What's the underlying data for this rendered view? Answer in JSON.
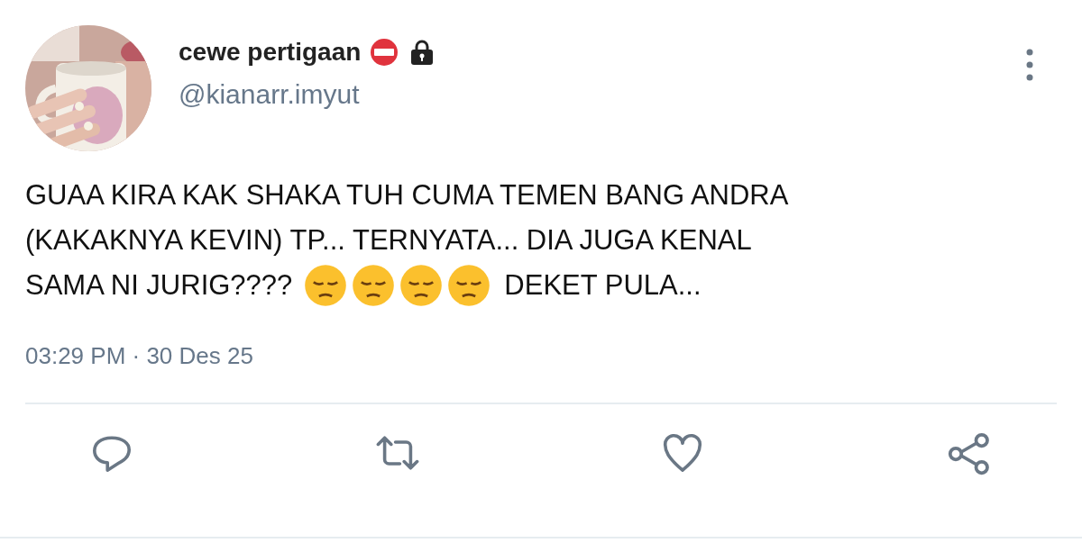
{
  "author": {
    "name": "cewe pertigaan",
    "handle": "@kianarr.imyut"
  },
  "body_lines": [
    [
      {
        "kind": "text",
        "text": "GUAA KIRA KAK SHAKA TUH CUMA TEMEN BANG ANDRA"
      }
    ],
    [
      {
        "kind": "text",
        "text": "(KAKAKNYA KEVIN) TP... TERNYATA... DIA JUGA KENAL"
      }
    ],
    [
      {
        "kind": "text",
        "text": "SAMA NI JURIG????"
      },
      {
        "kind": "emoji"
      },
      {
        "kind": "emoji"
      },
      {
        "kind": "emoji"
      },
      {
        "kind": "emoji"
      },
      {
        "kind": "text",
        "text": "DEKET PULA..."
      }
    ]
  ],
  "timestamp": "03:29 PM · 30 Des 25"
}
